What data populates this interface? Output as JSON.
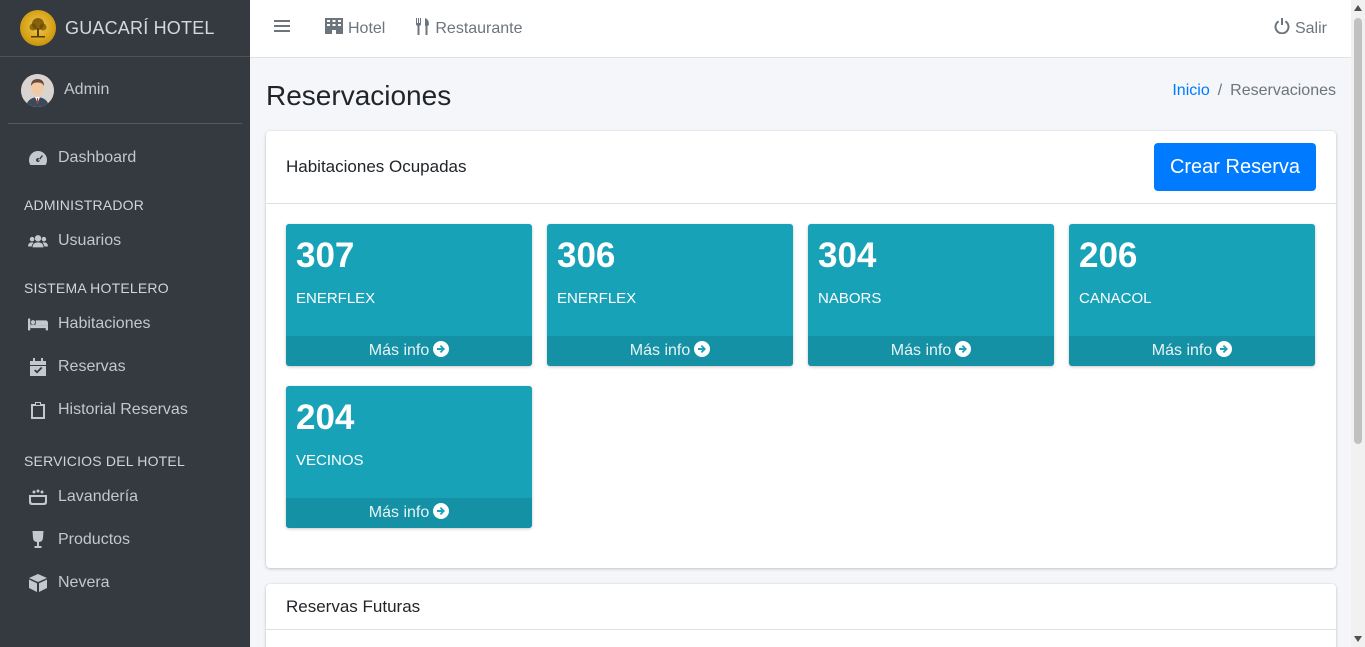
{
  "brand": {
    "name": "GUACARÍ HOTEL"
  },
  "user": {
    "name": "Admin"
  },
  "sidebar": {
    "dashboard": "Dashboard",
    "sections": [
      {
        "header": "ADMINISTRADOR",
        "items": [
          {
            "label": "Usuarios",
            "icon": "users-icon"
          }
        ]
      },
      {
        "header": "SISTEMA HOTELERO",
        "items": [
          {
            "label": "Habitaciones",
            "icon": "bed-icon"
          },
          {
            "label": "Reservas",
            "icon": "calendar-check-icon"
          },
          {
            "label": "Historial Reservas",
            "icon": "clipboard-icon"
          }
        ]
      },
      {
        "header": "SERVICIOS DEL HOTEL",
        "items": [
          {
            "label": "Lavandería",
            "icon": "laundry-icon"
          },
          {
            "label": "Productos",
            "icon": "glass-icon"
          },
          {
            "label": "Nevera",
            "icon": "box-icon"
          }
        ]
      }
    ]
  },
  "topbar": {
    "hotel": "Hotel",
    "restaurante": "Restaurante",
    "salir": "Salir"
  },
  "page": {
    "title": "Reservaciones",
    "breadcrumb": {
      "home": "Inicio",
      "sep": "/",
      "current": "Reservaciones"
    }
  },
  "occupied": {
    "title": "Habitaciones Ocupadas",
    "create_button": "Crear Reserva",
    "footer_label": "Más info",
    "rooms": [
      {
        "number": "307",
        "company": "ENERFLEX"
      },
      {
        "number": "306",
        "company": "ENERFLEX"
      },
      {
        "number": "304",
        "company": "NABORS"
      },
      {
        "number": "206",
        "company": "CANACOL"
      },
      {
        "number": "204",
        "company": "VECINOS"
      }
    ]
  },
  "future": {
    "title": "Reservas Futuras"
  },
  "colors": {
    "sidebar": "#343a40",
    "box": "#17a2b8",
    "primary": "#007bff"
  }
}
